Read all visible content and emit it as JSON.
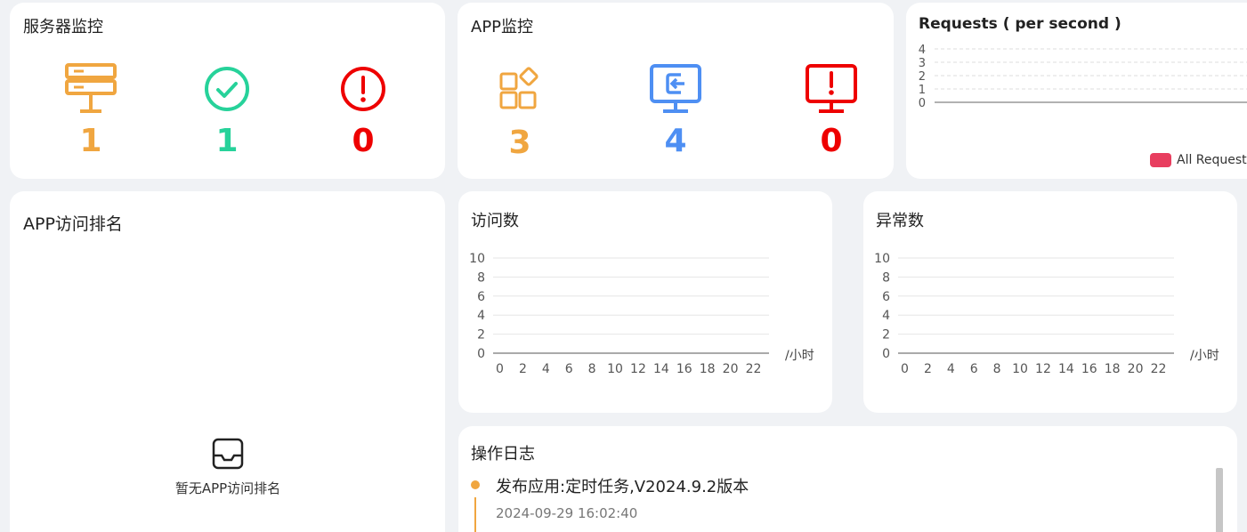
{
  "server_monitor": {
    "title": "服务器监控",
    "stats": [
      {
        "icon": "server-icon",
        "value": "1",
        "color": "#f0a640"
      },
      {
        "icon": "check-circle-icon",
        "value": "1",
        "color": "#27d29a"
      },
      {
        "icon": "error-circle-icon",
        "value": "0",
        "color": "#ee0000"
      }
    ]
  },
  "app_monitor": {
    "title": "APP监控",
    "stats": [
      {
        "icon": "apps-icon",
        "value": "3",
        "color": "#f0a640"
      },
      {
        "icon": "monitor-login-icon",
        "value": "4",
        "color": "#4e8ff3"
      },
      {
        "icon": "monitor-alert-icon",
        "value": "0",
        "color": "#ee0000"
      }
    ]
  },
  "requests": {
    "title": "Requests ( per second )",
    "legend": "All Request",
    "legend_color": "#e83e5f"
  },
  "app_ranking": {
    "title": "APP访问排名",
    "empty_text": "暂无APP访问排名"
  },
  "visits": {
    "title": "访问数",
    "unit": "/小时"
  },
  "exceptions": {
    "title": "异常数",
    "unit": "/小时"
  },
  "operation_log": {
    "title": "操作日志",
    "items": [
      {
        "title": "发布应用:定时任务,V2024.9.2版本",
        "time": "2024-09-29 16:02:40"
      }
    ]
  },
  "chart_data": [
    {
      "type": "line",
      "title": "Requests ( per second )",
      "series": [
        {
          "name": "All Request",
          "values": [
            0
          ]
        }
      ],
      "ylim": [
        0,
        4
      ],
      "yticks": [
        "4",
        "3",
        "2",
        "1",
        "0"
      ],
      "grid": true,
      "legend": "bottom-right"
    },
    {
      "type": "line",
      "title": "访问数",
      "x": [
        "0",
        "2",
        "4",
        "6",
        "8",
        "10",
        "12",
        "14",
        "16",
        "18",
        "20",
        "22"
      ],
      "yticks": [
        "10",
        "8",
        "6",
        "4",
        "2",
        "0"
      ],
      "ylim": [
        0,
        10
      ],
      "xlabel": "/小时",
      "grid": true
    },
    {
      "type": "line",
      "title": "异常数",
      "x": [
        "0",
        "2",
        "4",
        "6",
        "8",
        "10",
        "12",
        "14",
        "16",
        "18",
        "20",
        "22"
      ],
      "yticks": [
        "10",
        "8",
        "6",
        "4",
        "2",
        "0"
      ],
      "ylim": [
        0,
        10
      ],
      "xlabel": "/小时",
      "grid": true
    }
  ]
}
